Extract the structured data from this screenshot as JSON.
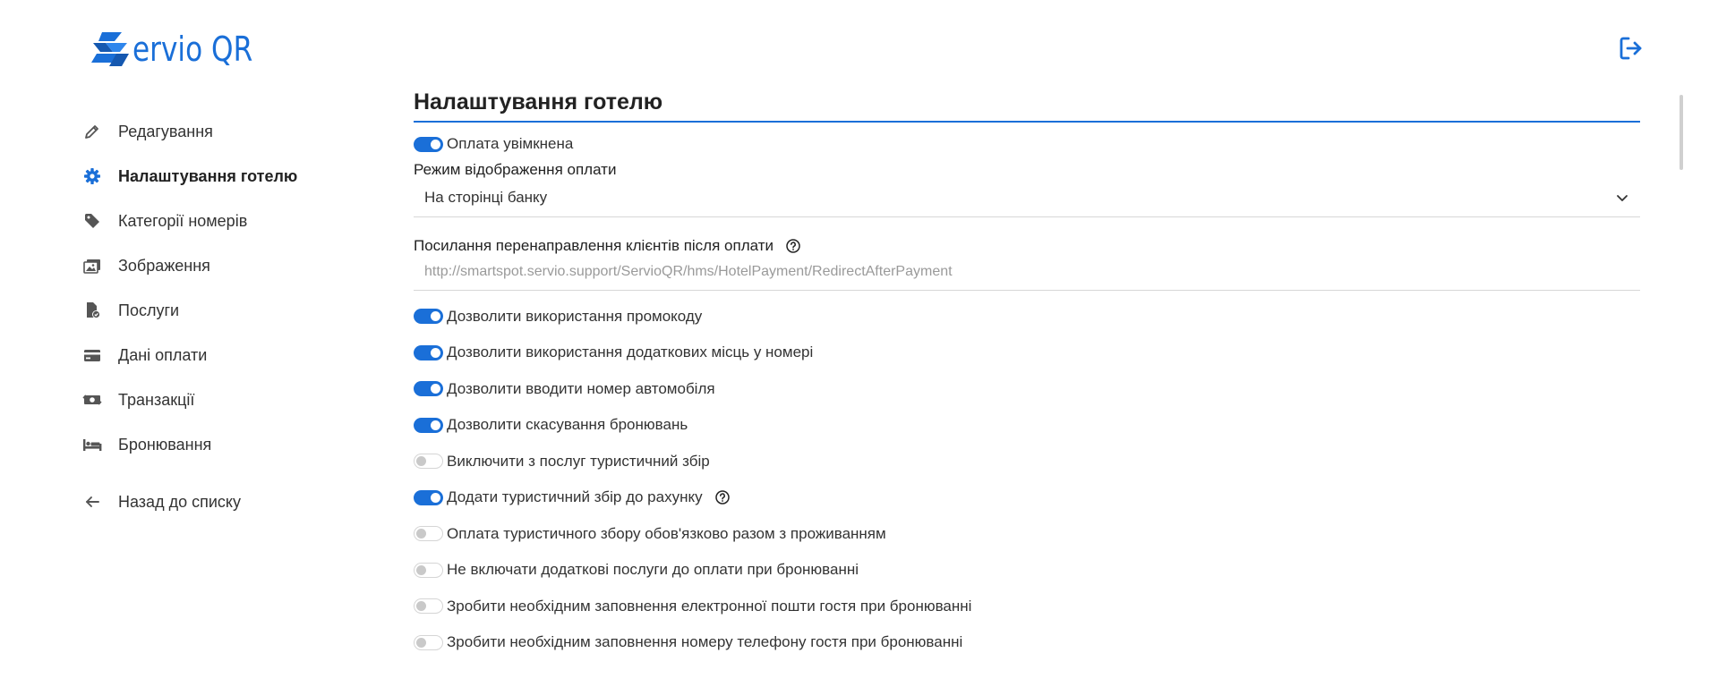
{
  "brand": {
    "logo_text": "ervio QR",
    "accent": "#1a6fd8"
  },
  "header": {
    "logout_icon": "logout-icon"
  },
  "sidebar": {
    "items": [
      {
        "label": "Редагування",
        "icon": "pencil-icon",
        "active": false
      },
      {
        "label": "Налаштування готелю",
        "icon": "gear-icon",
        "active": true
      },
      {
        "label": "Категорії номерів",
        "icon": "tag-icon",
        "active": false
      },
      {
        "label": "Зображення",
        "icon": "images-icon",
        "active": false
      },
      {
        "label": "Послуги",
        "icon": "file-check-icon",
        "active": false
      },
      {
        "label": "Дані оплати",
        "icon": "credit-card-icon",
        "active": false
      },
      {
        "label": "Транзакції",
        "icon": "money-icon",
        "active": false
      },
      {
        "label": "Бронювання",
        "icon": "bed-icon",
        "active": false
      }
    ],
    "back_label": "Назад до списку"
  },
  "main": {
    "title": "Налаштування готелю",
    "payment_enabled": {
      "label": "Оплата увімкнена",
      "on": true
    },
    "display_mode": {
      "label": "Режим відображення оплати",
      "value": "На сторінці банку"
    },
    "redirect": {
      "label": "Посилання перенаправлення клієнтів після оплати",
      "placeholder": "http://smartspot.servio.support/ServioQR/hms/HotelPayment/RedirectAfterPayment"
    },
    "toggles": [
      {
        "label": "Дозволити використання промокоду",
        "on": true,
        "help": false
      },
      {
        "label": "Дозволити використання додаткових місць у номері",
        "on": true,
        "help": false
      },
      {
        "label": "Дозволити вводити номер автомобіля",
        "on": true,
        "help": false
      },
      {
        "label": "Дозволити скасування бронювань",
        "on": true,
        "help": false
      },
      {
        "label": "Виключити з послуг туристичний збір",
        "on": false,
        "help": false
      },
      {
        "label": "Додати туристичний збір до рахунку",
        "on": true,
        "help": true
      },
      {
        "label": "Оплата туристичного збору обов'язково разом з проживанням",
        "on": false,
        "help": false
      },
      {
        "label": "Не включати додаткові послуги до оплати при бронюванні",
        "on": false,
        "help": false
      },
      {
        "label": "Зробити необхідним заповнення електронної пошти гостя при бронюванні",
        "on": false,
        "help": false
      },
      {
        "label": "Зробити необхідним заповнення номеру телефону гостя при бронюванні",
        "on": false,
        "help": false
      }
    ]
  }
}
